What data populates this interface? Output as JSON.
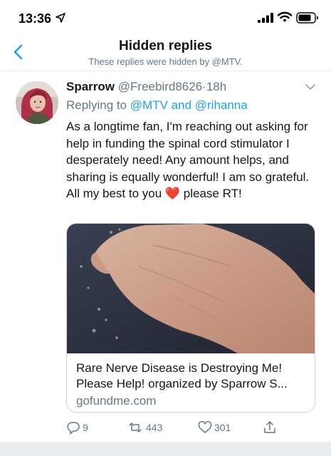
{
  "status_bar": {
    "time": "13:36"
  },
  "nav": {
    "title": "Hidden replies",
    "subtitle": "These replies were hidden by @MTV."
  },
  "tweet": {
    "name": "Sparrow",
    "handle": "@Freebird8626",
    "separator": "·",
    "time": "18h",
    "replying_prefix": "Replying to ",
    "mention1": "@MTV",
    "replying_and": " and ",
    "mention2": "@rihanna",
    "text": "As a longtime fan, I'm reaching out asking for help in funding the spinal cord stimulator I desperately need! Any amount helps, and sharing is equally wonderful! I am so grateful. All my best to you ",
    "text_emoji": "❤️",
    "text_end": " please RT!",
    "card": {
      "title": "Rare Nerve Disease is Destroying Me! Please Help! organized by Sparrow S...",
      "domain": "gofundme.com"
    },
    "actions": {
      "reply_count": "9",
      "retweet_count": "443",
      "like_count": "301"
    }
  },
  "colors": {
    "accent": "#1da1f2",
    "secondary_text": "#657786",
    "heart": "#e0245e"
  },
  "icons": [
    "location-arrow-icon",
    "signal-icon",
    "wifi-icon",
    "battery-icon",
    "back-arrow-icon",
    "chevron-down-icon",
    "reply-icon",
    "retweet-icon",
    "like-icon",
    "share-icon"
  ]
}
